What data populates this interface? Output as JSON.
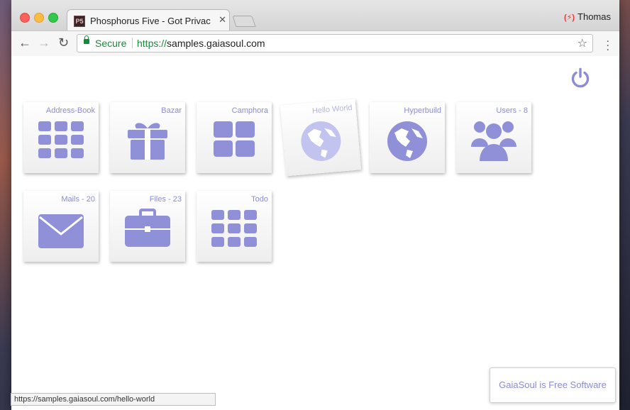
{
  "browser": {
    "tab_title": "Phosphorus Five - Got Privacy",
    "tab_close": "✕",
    "favicon_text": "P5",
    "profile_name": "Thomas",
    "secure_label": "Secure",
    "url_scheme": "https://",
    "url_host": "samples.gaiasoul.com"
  },
  "apps": [
    {
      "label": "Address-Book",
      "icon": "grid-icon"
    },
    {
      "label": "Bazar",
      "icon": "gift-icon"
    },
    {
      "label": "Camphora",
      "icon": "large-grid-icon"
    },
    {
      "label": "Hello World",
      "icon": "globe-icon"
    },
    {
      "label": "Hyperbuild",
      "icon": "globe-icon"
    },
    {
      "label": "Users - 8",
      "icon": "users-icon"
    },
    {
      "label": "Mails - 20",
      "icon": "envelope-icon"
    },
    {
      "label": "Files - 23",
      "icon": "briefcase-icon"
    },
    {
      "label": "Todo",
      "icon": "grid-icon"
    }
  ],
  "footer": {
    "status_url": "https://samples.gaiasoul.com/hello-world",
    "free_software": "GaiaSoul is Free Software"
  },
  "colors": {
    "accent": "#8c8cd6",
    "icon": "#9090d8",
    "secure": "#178a3a"
  }
}
